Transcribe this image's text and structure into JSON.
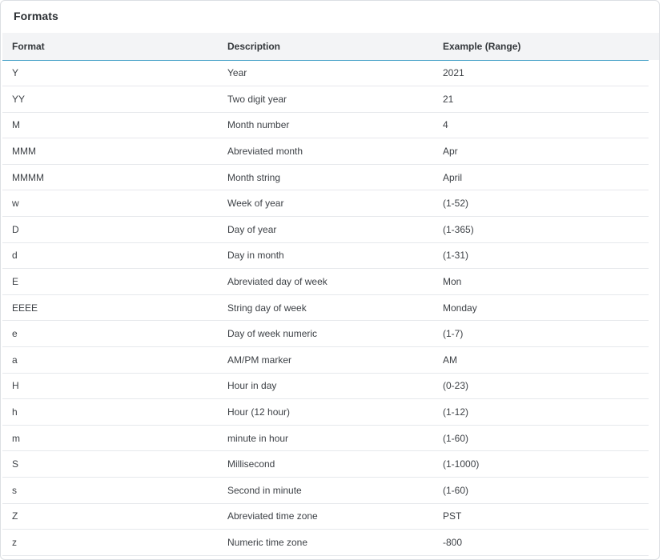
{
  "panel": {
    "title": "Formats"
  },
  "table": {
    "headers": [
      "Format",
      "Description",
      "Example (Range)"
    ],
    "rows": [
      [
        "Y",
        "Year",
        "2021"
      ],
      [
        "YY",
        "Two digit year",
        "21"
      ],
      [
        "M",
        "Month number",
        "4"
      ],
      [
        "MMM",
        "Abreviated month",
        "Apr"
      ],
      [
        "MMMM",
        "Month string",
        "April"
      ],
      [
        "w",
        "Week of year",
        "(1-52)"
      ],
      [
        "D",
        "Day of year",
        "(1-365)"
      ],
      [
        "d",
        "Day in month",
        "(1-31)"
      ],
      [
        "E",
        "Abreviated day of week",
        "Mon"
      ],
      [
        "EEEE",
        "String day of week",
        "Monday"
      ],
      [
        "e",
        "Day of week numeric",
        "(1-7)"
      ],
      [
        "a",
        "AM/PM marker",
        "AM"
      ],
      [
        "H",
        "Hour in day",
        "(0-23)"
      ],
      [
        "h",
        "Hour (12 hour)",
        "(1-12)"
      ],
      [
        "m",
        "minute in hour",
        "(1-60)"
      ],
      [
        "S",
        "Millisecond",
        "(1-1000)"
      ],
      [
        "s",
        "Second in minute",
        "(1-60)"
      ],
      [
        "Z",
        "Abreviated time zone",
        "PST"
      ],
      [
        "z",
        "Numeric time zone",
        "-800"
      ]
    ]
  },
  "colors": {
    "header_bg": "#f3f4f6",
    "header_accent_line": "#4aa3c9",
    "row_divider": "#e6e8eb",
    "text": "#3d4146"
  }
}
